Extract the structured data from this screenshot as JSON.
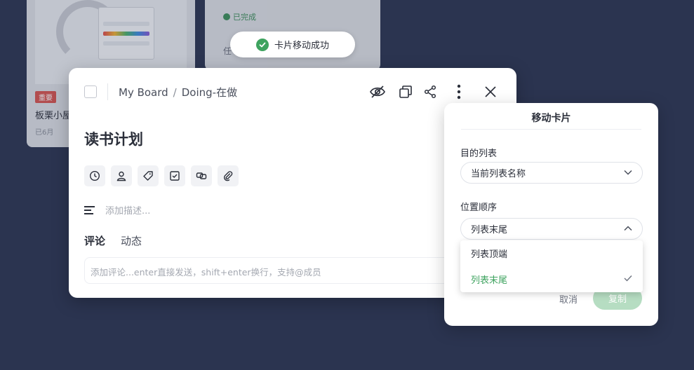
{
  "toast": {
    "message": "卡片移动成功"
  },
  "background": {
    "card_tag": "重要",
    "card_title": "板栗小屋",
    "card_meta": "已6月",
    "done_label": "已完成",
    "second_line": "任"
  },
  "card": {
    "breadcrumb": {
      "board": "My Board",
      "separator": "/",
      "list": "Doing-在做"
    },
    "title": "读书计划",
    "description_placeholder": "添加描述...",
    "tabs": [
      {
        "label": "评论"
      },
      {
        "label": "动态"
      }
    ],
    "comment_placeholder": "添加评论...enter直接发送，shift+enter换行，支持@成员",
    "tool_icons": [
      "clock-icon",
      "member-icon",
      "tag-icon",
      "checklist-icon",
      "copy-link-icon",
      "attachment-icon"
    ],
    "header_icons": [
      "eye-off-icon",
      "copy-icon",
      "share-icon",
      "more-icon",
      "close-icon"
    ]
  },
  "move_popover": {
    "title": "移动卡片",
    "target_list_label": "目的列表",
    "target_list_value": "当前列表名称",
    "position_label": "位置顺序",
    "position_value": "列表末尾",
    "position_options": [
      {
        "label": "列表顶端",
        "selected": false
      },
      {
        "label": "列表末尾",
        "selected": true
      }
    ],
    "cancel_label": "取消",
    "copy_label": "复制"
  },
  "colors": {
    "background": "#2b3450",
    "accent_green": "#3ea35f",
    "copy_button_disabled": "#b6ddc2"
  }
}
